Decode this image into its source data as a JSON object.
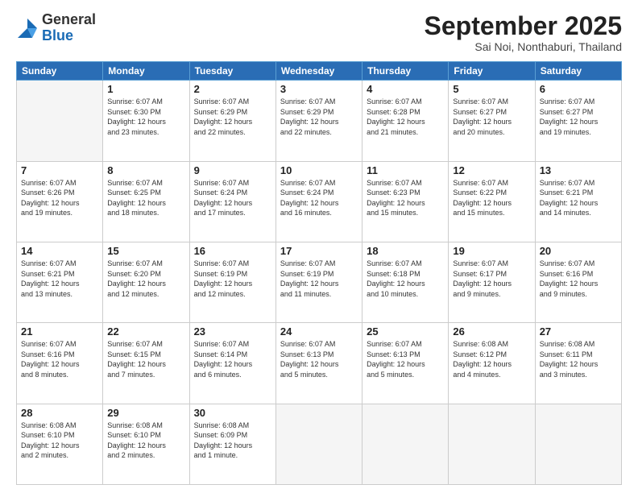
{
  "header": {
    "logo_general": "General",
    "logo_blue": "Blue",
    "month_title": "September 2025",
    "location": "Sai Noi, Nonthaburi, Thailand"
  },
  "days_of_week": [
    "Sunday",
    "Monday",
    "Tuesday",
    "Wednesday",
    "Thursday",
    "Friday",
    "Saturday"
  ],
  "weeks": [
    [
      {
        "day": "",
        "info": ""
      },
      {
        "day": "1",
        "info": "Sunrise: 6:07 AM\nSunset: 6:30 PM\nDaylight: 12 hours\nand 23 minutes."
      },
      {
        "day": "2",
        "info": "Sunrise: 6:07 AM\nSunset: 6:29 PM\nDaylight: 12 hours\nand 22 minutes."
      },
      {
        "day": "3",
        "info": "Sunrise: 6:07 AM\nSunset: 6:29 PM\nDaylight: 12 hours\nand 22 minutes."
      },
      {
        "day": "4",
        "info": "Sunrise: 6:07 AM\nSunset: 6:28 PM\nDaylight: 12 hours\nand 21 minutes."
      },
      {
        "day": "5",
        "info": "Sunrise: 6:07 AM\nSunset: 6:27 PM\nDaylight: 12 hours\nand 20 minutes."
      },
      {
        "day": "6",
        "info": "Sunrise: 6:07 AM\nSunset: 6:27 PM\nDaylight: 12 hours\nand 19 minutes."
      }
    ],
    [
      {
        "day": "7",
        "info": "Sunrise: 6:07 AM\nSunset: 6:26 PM\nDaylight: 12 hours\nand 19 minutes."
      },
      {
        "day": "8",
        "info": "Sunrise: 6:07 AM\nSunset: 6:25 PM\nDaylight: 12 hours\nand 18 minutes."
      },
      {
        "day": "9",
        "info": "Sunrise: 6:07 AM\nSunset: 6:24 PM\nDaylight: 12 hours\nand 17 minutes."
      },
      {
        "day": "10",
        "info": "Sunrise: 6:07 AM\nSunset: 6:24 PM\nDaylight: 12 hours\nand 16 minutes."
      },
      {
        "day": "11",
        "info": "Sunrise: 6:07 AM\nSunset: 6:23 PM\nDaylight: 12 hours\nand 15 minutes."
      },
      {
        "day": "12",
        "info": "Sunrise: 6:07 AM\nSunset: 6:22 PM\nDaylight: 12 hours\nand 15 minutes."
      },
      {
        "day": "13",
        "info": "Sunrise: 6:07 AM\nSunset: 6:21 PM\nDaylight: 12 hours\nand 14 minutes."
      }
    ],
    [
      {
        "day": "14",
        "info": "Sunrise: 6:07 AM\nSunset: 6:21 PM\nDaylight: 12 hours\nand 13 minutes."
      },
      {
        "day": "15",
        "info": "Sunrise: 6:07 AM\nSunset: 6:20 PM\nDaylight: 12 hours\nand 12 minutes."
      },
      {
        "day": "16",
        "info": "Sunrise: 6:07 AM\nSunset: 6:19 PM\nDaylight: 12 hours\nand 12 minutes."
      },
      {
        "day": "17",
        "info": "Sunrise: 6:07 AM\nSunset: 6:19 PM\nDaylight: 12 hours\nand 11 minutes."
      },
      {
        "day": "18",
        "info": "Sunrise: 6:07 AM\nSunset: 6:18 PM\nDaylight: 12 hours\nand 10 minutes."
      },
      {
        "day": "19",
        "info": "Sunrise: 6:07 AM\nSunset: 6:17 PM\nDaylight: 12 hours\nand 9 minutes."
      },
      {
        "day": "20",
        "info": "Sunrise: 6:07 AM\nSunset: 6:16 PM\nDaylight: 12 hours\nand 9 minutes."
      }
    ],
    [
      {
        "day": "21",
        "info": "Sunrise: 6:07 AM\nSunset: 6:16 PM\nDaylight: 12 hours\nand 8 minutes."
      },
      {
        "day": "22",
        "info": "Sunrise: 6:07 AM\nSunset: 6:15 PM\nDaylight: 12 hours\nand 7 minutes."
      },
      {
        "day": "23",
        "info": "Sunrise: 6:07 AM\nSunset: 6:14 PM\nDaylight: 12 hours\nand 6 minutes."
      },
      {
        "day": "24",
        "info": "Sunrise: 6:07 AM\nSunset: 6:13 PM\nDaylight: 12 hours\nand 5 minutes."
      },
      {
        "day": "25",
        "info": "Sunrise: 6:07 AM\nSunset: 6:13 PM\nDaylight: 12 hours\nand 5 minutes."
      },
      {
        "day": "26",
        "info": "Sunrise: 6:08 AM\nSunset: 6:12 PM\nDaylight: 12 hours\nand 4 minutes."
      },
      {
        "day": "27",
        "info": "Sunrise: 6:08 AM\nSunset: 6:11 PM\nDaylight: 12 hours\nand 3 minutes."
      }
    ],
    [
      {
        "day": "28",
        "info": "Sunrise: 6:08 AM\nSunset: 6:10 PM\nDaylight: 12 hours\nand 2 minutes."
      },
      {
        "day": "29",
        "info": "Sunrise: 6:08 AM\nSunset: 6:10 PM\nDaylight: 12 hours\nand 2 minutes."
      },
      {
        "day": "30",
        "info": "Sunrise: 6:08 AM\nSunset: 6:09 PM\nDaylight: 12 hours\nand 1 minute."
      },
      {
        "day": "",
        "info": ""
      },
      {
        "day": "",
        "info": ""
      },
      {
        "day": "",
        "info": ""
      },
      {
        "day": "",
        "info": ""
      }
    ]
  ]
}
